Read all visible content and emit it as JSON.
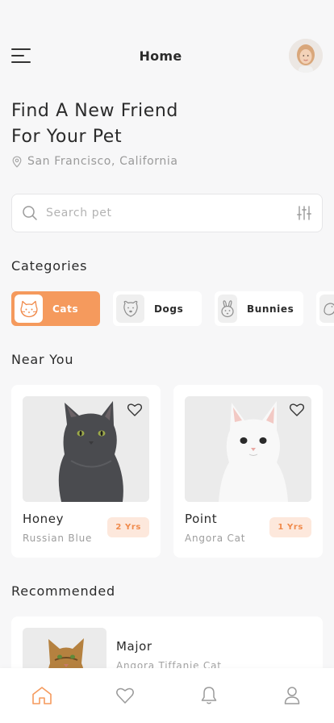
{
  "header": {
    "title": "Home",
    "menu_icon": "hamburger-menu-icon",
    "avatar_icon": "user-avatar"
  },
  "hero": {
    "title_line1": "Find A New Friend",
    "title_line2": "For Your Pet",
    "location": "San Francisco, California",
    "location_icon": "location-pin-icon"
  },
  "search": {
    "placeholder": "Search pet",
    "search_icon": "search-icon",
    "filter_icon": "filter-sliders-icon"
  },
  "categories": {
    "title": "Categories",
    "items": [
      {
        "label": "Cats",
        "icon": "cat-icon",
        "active": true
      },
      {
        "label": "Dogs",
        "icon": "dog-icon",
        "active": false
      },
      {
        "label": "Bunnies",
        "icon": "bunny-icon",
        "active": false
      },
      {
        "label": "",
        "icon": "bird-icon",
        "active": false
      }
    ]
  },
  "near_you": {
    "title": "Near You",
    "pets": [
      {
        "name": "Honey",
        "breed": "Russian Blue",
        "age": "2 Yrs"
      },
      {
        "name": "Point",
        "breed": "Angora Cat",
        "age": "1 Yrs"
      }
    ]
  },
  "recommended": {
    "title": "Recommended",
    "pets": [
      {
        "name": "Major",
        "breed": "Angora Tiffanie Cat"
      }
    ]
  },
  "tabbar": {
    "items": [
      {
        "icon": "home-icon",
        "active": true
      },
      {
        "icon": "heart-icon",
        "active": false
      },
      {
        "icon": "bell-icon",
        "active": false
      },
      {
        "icon": "profile-icon",
        "active": false
      }
    ]
  },
  "colors": {
    "accent": "#f59a5d",
    "badge_bg": "#fde8dc",
    "badge_text": "#f08a4b",
    "background": "#f7f7f8"
  }
}
